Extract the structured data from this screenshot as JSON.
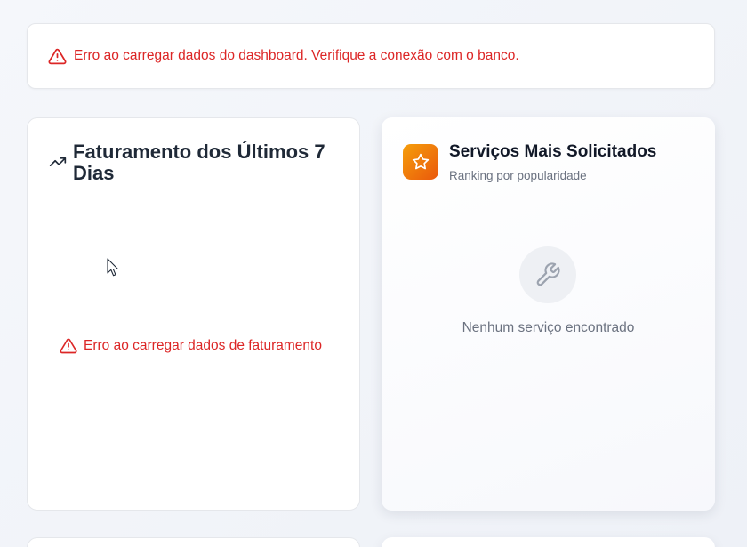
{
  "dashboard_error": {
    "message": "Erro ao carregar dados do dashboard. Verifique a conexão com o banco."
  },
  "revenue_card": {
    "title": "Faturamento dos Últimos 7 Dias",
    "error_message": "Erro ao carregar dados de faturamento"
  },
  "services_card": {
    "title": "Serviços Mais Solicitados",
    "subtitle": "Ranking por popularidade",
    "empty_message": "Nenhum serviço encontrado"
  },
  "colors": {
    "error": "#dc2626",
    "accent_orange": "#f97316"
  },
  "icons": {
    "banner": "alert-triangle-icon",
    "trend": "trending-up-icon",
    "star": "star-icon",
    "wrench": "wrench-icon"
  }
}
